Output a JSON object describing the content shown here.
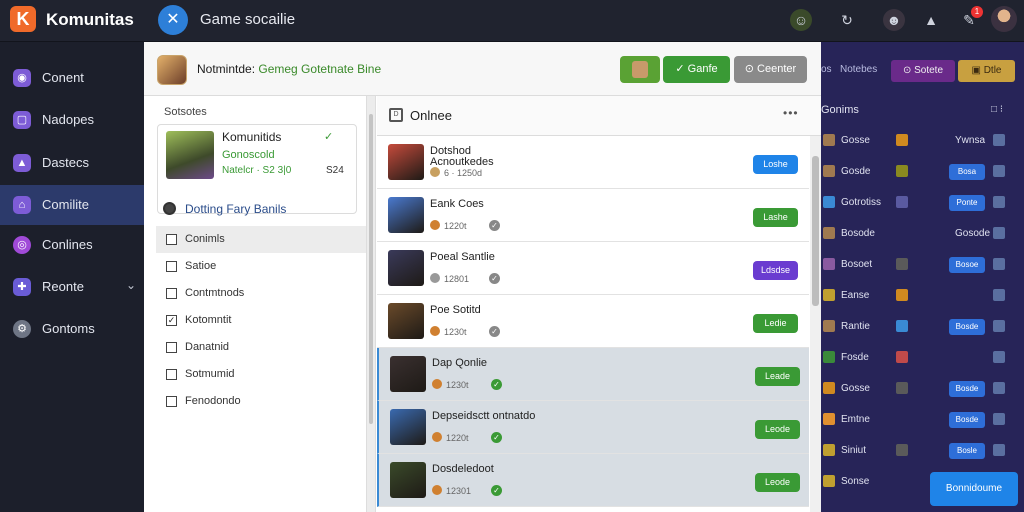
{
  "app": {
    "logo": "K",
    "title": "Komunitas"
  },
  "window": {
    "icon": "vs-icon",
    "title": "Game socailie"
  },
  "topbar_icons": [
    "character-icon",
    "refresh-icon",
    "user-icon",
    "notification-icon",
    "tools-icon"
  ],
  "topbar_badge": "1",
  "sidebar": {
    "items": [
      {
        "label": "Conent",
        "icon": "chat-icon",
        "color": "#7d5cd6"
      },
      {
        "label": "Nadopes",
        "icon": "page-icon",
        "color": "#7d5cd6"
      },
      {
        "label": "Dastecs",
        "icon": "chart-icon",
        "color": "#7d5cd6"
      },
      {
        "label": "Comilite",
        "icon": "community-icon",
        "color": "#7d5cd6",
        "active": true
      },
      {
        "label": "Conlines",
        "icon": "globe-icon",
        "color": "#a04ad8"
      },
      {
        "label": "Reonte",
        "icon": "puzzle-icon",
        "color": "#6a5cd6",
        "chevron": "⌄"
      },
      {
        "label": "Gontoms",
        "icon": "gear-icon",
        "color": "#6e7585"
      }
    ]
  },
  "modal": {
    "title_prefix": "Notmintde:",
    "title_accent": "Gemeg Gotetnate Bine",
    "btn_primary": "✓ Ganfe",
    "btn_secondary": "⊙ Ceenter"
  },
  "left_panel": {
    "caption": "Sotsotes",
    "card": {
      "name": "Komunitids",
      "check": "✓",
      "status": "Gonoscold",
      "meta": "Natelcr ·  S2 3|0",
      "meta2": "S24"
    },
    "radio_label": "Dotting Fary Banils",
    "options": [
      {
        "label": "Conimls",
        "mark": "",
        "selected": true
      },
      {
        "label": "Satioe",
        "mark": ""
      },
      {
        "label": "Contmtnods",
        "mark": ""
      },
      {
        "label": "Kotomntit",
        "mark": "✓"
      },
      {
        "label": "Danatnid",
        "mark": ""
      },
      {
        "label": "Sotmumid",
        "mark": ""
      },
      {
        "label": "Fenodondo",
        "mark": ""
      }
    ]
  },
  "right_panel": {
    "title": "Onlnee",
    "menu": "•••",
    "rows": [
      {
        "title": "Dotshod\nAcnoutkedes",
        "meta": "6 ·  1250d",
        "btn": "Loshe",
        "btn_color": "#1f84e8",
        "thumb": "#c64b3c",
        "dot": "#c8a060",
        "chk": "",
        "highlight": false
      },
      {
        "title": "Eank Coes",
        "meta": "1220t",
        "btn": "Lashe",
        "btn_color": "#3a9a35",
        "thumb": "#4a7ad0",
        "dot": "#d08030",
        "chk": "#888",
        "highlight": false
      },
      {
        "title": "Poeal Santlie",
        "meta": "12801",
        "btn": "Ldsdse",
        "btn_color": "#6a3cd0",
        "thumb": "#3a3a5a",
        "dot": "#999",
        "chk": "#888",
        "highlight": false
      },
      {
        "title": "Poe Sotitd",
        "meta": "1230t",
        "btn": "Ledie",
        "btn_color": "#3a9a35",
        "thumb": "#6a4a2a",
        "dot": "#d08030",
        "chk": "#888",
        "highlight": false
      },
      {
        "title": "Dap Qonlie",
        "meta": "1230t",
        "btn": "Leade",
        "btn_color": "#3a9a35",
        "thumb": "#3a3030",
        "dot": "#d08030",
        "chk": "#3a9a35",
        "highlight": true
      },
      {
        "title": "Depseidsctt ontnatdo",
        "meta": "1220t",
        "btn": "Leode",
        "btn_color": "#3a9a35",
        "thumb": "#3a6ab0",
        "dot": "#d08030",
        "chk": "#3a9a35",
        "highlight": true
      },
      {
        "title": "Dosdeledoot",
        "meta": "12301",
        "btn": "Leode",
        "btn_color": "#3a9a35",
        "thumb": "#3a4a2a",
        "dot": "#d08030",
        "chk": "#3a9a35",
        "highlight": true
      }
    ]
  },
  "backdrop": {
    "header_labels": [
      "os",
      "Notebes"
    ],
    "chip_purple": "⊙ Sotete",
    "chip_gold": "▣ Dtle",
    "list_title": "Gonims",
    "list_title_side": "□ ⁝",
    "rows": [
      {
        "label": "Gosse",
        "side": "#d08a20",
        "text_right": "Ywnsa",
        "btn": "",
        "icon": "#a07a50"
      },
      {
        "label": "Gosde",
        "side": "#8a8a20",
        "text_right": "",
        "btn": "Bosa",
        "icon": "#a07a50"
      },
      {
        "label": "Gotrotiss",
        "side": "#5a5aa0",
        "text_right": "",
        "btn": "Ponte",
        "icon": "#3a8ad4"
      },
      {
        "label": "Bosode",
        "side": "",
        "text_right": "Gosode",
        "btn": "",
        "icon": "#a07a50"
      },
      {
        "label": "Bosoet",
        "side": "#5a5a5a",
        "text_right": "",
        "btn": "Bosoe",
        "icon": "#8a5aa0"
      },
      {
        "label": "Eanse",
        "side": "#d08a20",
        "text_right": "",
        "btn": "",
        "icon": "#c0a030"
      },
      {
        "label": "Rantie",
        "side": "#3a8ad4",
        "text_right": "",
        "btn": "Bosde",
        "icon": "#a07a50"
      },
      {
        "label": "Fosde",
        "side": "#c04a4a",
        "text_right": "",
        "btn": "",
        "icon": "#3a8a3a"
      },
      {
        "label": "Gosse",
        "side": "#5a5a5a",
        "text_right": "",
        "btn": "Bosde",
        "icon": "#d08a20"
      },
      {
        "label": "Emtne",
        "side": "",
        "text_right": "",
        "btn": "Bosde",
        "icon": "#e09030"
      },
      {
        "label": "Siniut",
        "side": "#5a5a5a",
        "text_right": "",
        "btn": "Bosle",
        "icon": "#c0a030"
      },
      {
        "label": "Sonse",
        "side": "",
        "text_right": "",
        "btn": "",
        "icon": "#c0a030"
      }
    ],
    "cta": "Bonnidoume"
  }
}
